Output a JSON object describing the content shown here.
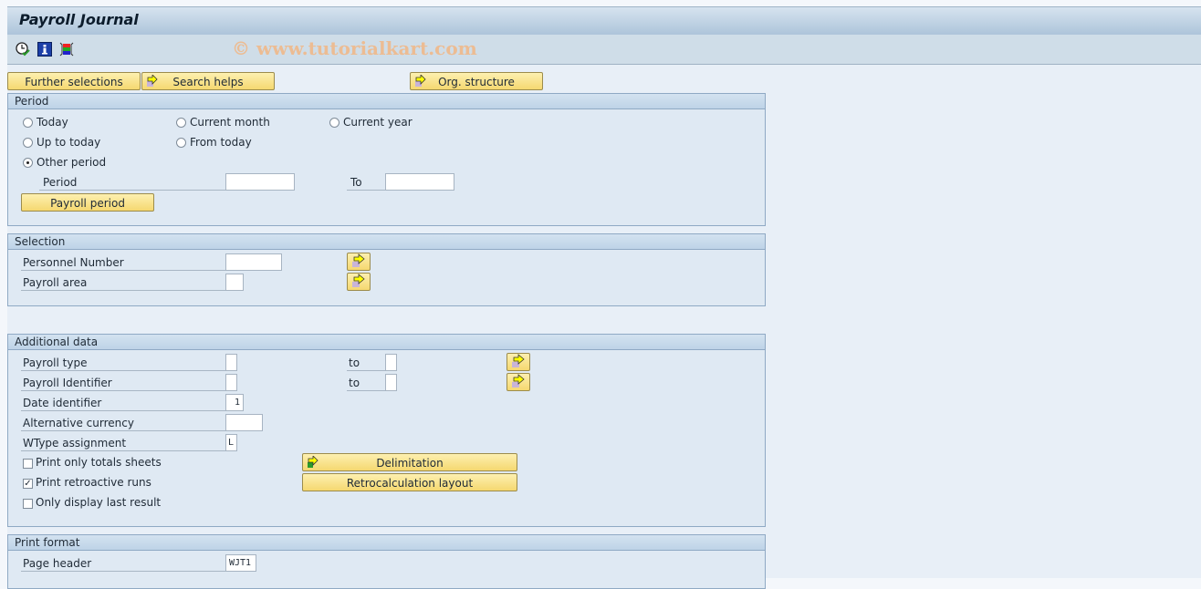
{
  "window": {
    "title": "Payroll Journal",
    "watermark": "© www.tutorialkart.com"
  },
  "toolbar": {
    "icons": [
      "execute-clock-icon",
      "info-icon",
      "layout-icon"
    ]
  },
  "buttons": {
    "further_selections": "Further selections",
    "search_helps": "Search helps",
    "org_structure": "Org. structure",
    "payroll_period": "Payroll period",
    "delimitation": "Delimitation",
    "retrocalculation_layout": "Retrocalculation layout"
  },
  "period": {
    "title": "Period",
    "options": [
      {
        "label": "Today",
        "selected": false
      },
      {
        "label": "Current month",
        "selected": false
      },
      {
        "label": "Current year",
        "selected": false
      },
      {
        "label": "Up to today",
        "selected": false
      },
      {
        "label": "From today",
        "selected": false
      },
      {
        "label": "Other period",
        "selected": true
      }
    ],
    "period_label": "Period",
    "period_from": "",
    "to_label": "To",
    "period_to": ""
  },
  "selection": {
    "title": "Selection",
    "personnel_number_label": "Personnel Number",
    "personnel_number": "",
    "payroll_area_label": "Payroll area",
    "payroll_area": ""
  },
  "additional": {
    "title": "Additional data",
    "payroll_type_label": "Payroll type",
    "payroll_type_from": "",
    "payroll_type_to": "",
    "payroll_identifier_label": "Payroll Identifier",
    "payroll_identifier_from": "",
    "payroll_identifier_to": "",
    "to_label": "to",
    "date_identifier_label": "Date identifier",
    "date_identifier": "1",
    "alt_currency_label": "Alternative currency",
    "alt_currency": "",
    "wtype_label": "WType assignment",
    "wtype": "L",
    "checkboxes": [
      {
        "label": "Print only totals sheets",
        "checked": false
      },
      {
        "label": "Print retroactive runs",
        "checked": true
      },
      {
        "label": "Only display last result",
        "checked": false
      }
    ]
  },
  "print_format": {
    "title": "Print format",
    "page_header_label": "Page header",
    "page_header": "WJT1"
  }
}
